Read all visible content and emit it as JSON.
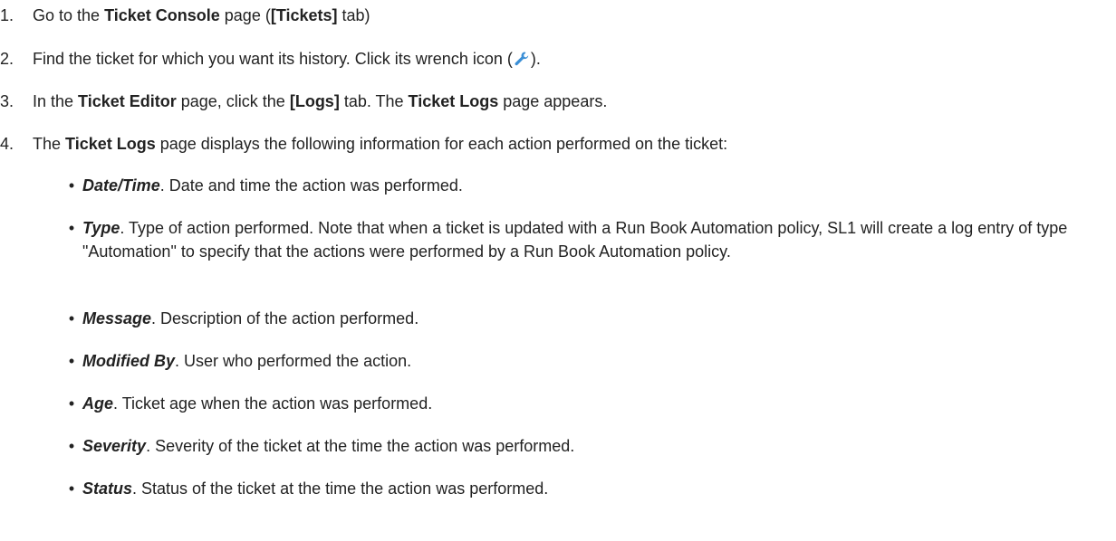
{
  "steps": [
    {
      "num": "1.",
      "pre": "Go to the ",
      "b1": "Ticket Console",
      "mid": " page (",
      "b2": "[Tickets]",
      "post": " tab)"
    },
    {
      "num": "2.",
      "pre": "Find the ticket for which you want its history. Click its wrench icon (",
      "icon": "wrench-icon",
      "post": ")."
    },
    {
      "num": "3.",
      "pre": "In the ",
      "b1": "Ticket Editor",
      "mid": " page, click the ",
      "b2": "[Logs]",
      "mid2": " tab. The ",
      "b3": "Ticket Logs",
      "post": " page appears."
    },
    {
      "num": "4.",
      "pre": "The ",
      "b1": "Ticket Logs",
      "post": " page displays the following information for each action performed on the ticket:"
    }
  ],
  "bullets": [
    {
      "term": "Date/Time",
      "desc": ". Date and time the action was performed."
    },
    {
      "term": "Type",
      "desc": ". Type of action performed. Note that when a ticket is updated with a Run Book Automation policy, SL1 will create a log entry of type \"Automation\" to specify that the actions were performed by a Run Book Automation policy."
    },
    {
      "term": "Message",
      "desc": ". Description of the action performed."
    },
    {
      "term": "Modified By",
      "desc": ". User who performed the action."
    },
    {
      "term": "Age",
      "desc": ". Ticket age when the action was performed."
    },
    {
      "term": "Severity",
      "desc": ". Severity of the ticket at the time the action was performed."
    },
    {
      "term": "Status",
      "desc": ". Status of the ticket at the time the action was performed."
    }
  ],
  "colors": {
    "text": "#222222",
    "wrench_icon": "#3b8fd6"
  }
}
